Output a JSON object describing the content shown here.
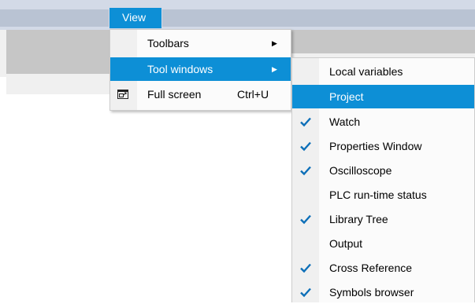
{
  "menubar": {
    "view_label": "View"
  },
  "view_menu": {
    "items": [
      {
        "label": "Toolbars",
        "has_submenu": true
      },
      {
        "label": "Tool windows",
        "has_submenu": true,
        "highlighted": true
      },
      {
        "label": "Full screen",
        "shortcut": "Ctrl+U",
        "icon": "fullscreen-icon"
      }
    ]
  },
  "tool_windows_menu": {
    "items": [
      {
        "label": "Local variables",
        "checked": false
      },
      {
        "label": "Project",
        "checked": false,
        "highlighted": true
      },
      {
        "label": "Watch",
        "checked": true
      },
      {
        "label": "Properties Window",
        "checked": true
      },
      {
        "label": "Oscilloscope",
        "checked": true
      },
      {
        "label": "PLC run-time status",
        "checked": false
      },
      {
        "label": "Library Tree",
        "checked": true
      },
      {
        "label": "Output",
        "checked": false
      },
      {
        "label": "Cross Reference",
        "checked": true
      },
      {
        "label": "Symbols browser",
        "checked": true
      }
    ]
  },
  "colors": {
    "highlight": "#0d8fd6",
    "checkmark": "#0d6fb8",
    "menubar": "#d3dae7"
  }
}
